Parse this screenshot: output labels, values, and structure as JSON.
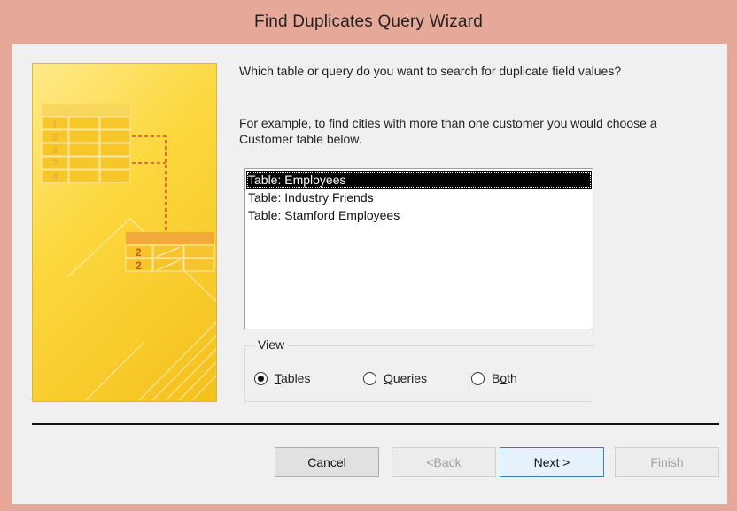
{
  "window": {
    "title": "Find Duplicates Query Wizard"
  },
  "question": "Which table or query do you want to search for duplicate field values?",
  "example": "For example, to find cities with more than one customer you would choose a Customer table below.",
  "list": {
    "items": [
      "Table: Employees",
      "Table: Industry Friends",
      "Table: Stamford Employees"
    ],
    "selected_index": 0
  },
  "view": {
    "label": "View",
    "options": [
      {
        "pre": "",
        "accel": "T",
        "post": "ables",
        "selected": true
      },
      {
        "pre": "",
        "accel": "Q",
        "post": "ueries",
        "selected": false
      },
      {
        "pre": "B",
        "accel": "o",
        "post": "th",
        "selected": false
      }
    ]
  },
  "art": {
    "row_numbers_left": [
      "1",
      "2",
      "3",
      "2",
      "4"
    ],
    "row_numbers_right": [
      "2",
      "2"
    ]
  },
  "buttons": {
    "cancel": "Cancel",
    "back": {
      "pre": "< ",
      "accel": "B",
      "post": "ack"
    },
    "next": {
      "pre": "",
      "accel": "N",
      "post": "ext >"
    },
    "finish": {
      "pre": "",
      "accel": "F",
      "post": "inish"
    }
  },
  "colors": {
    "title_bar": "#e6a898",
    "selection": "#000000",
    "art_yellow": "#fcd83e"
  }
}
